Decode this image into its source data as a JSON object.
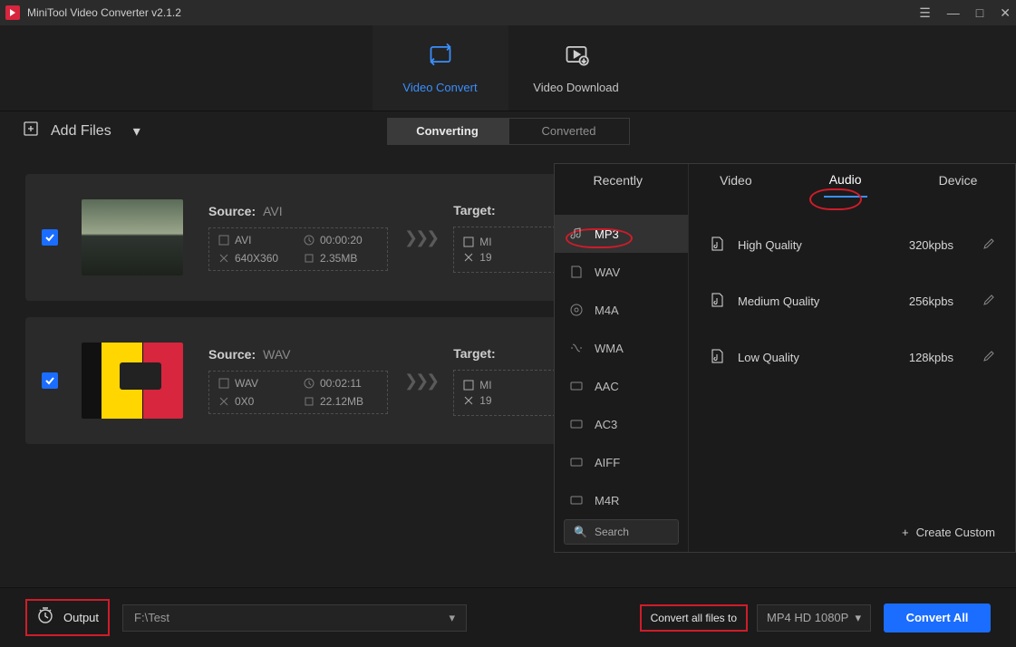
{
  "app": {
    "title": "MiniTool Video Converter v2.1.2"
  },
  "nav": {
    "convert": "Video Convert",
    "download": "Video Download"
  },
  "toolbar": {
    "add_files": "Add Files",
    "converting": "Converting",
    "converted": "Converted"
  },
  "files": [
    {
      "source_label": "Source:",
      "source_fmt": "AVI",
      "codec": "AVI",
      "duration": "00:00:20",
      "res": "640X360",
      "size": "2.35MB",
      "target_label": "Target:",
      "t_codec": "MI",
      "t_res": "19"
    },
    {
      "source_label": "Source:",
      "source_fmt": "WAV",
      "codec": "WAV",
      "duration": "00:02:11",
      "res": "0X0",
      "size": "22.12MB",
      "target_label": "Target:",
      "t_codec": "MI",
      "t_res": "19"
    }
  ],
  "popup": {
    "tabs": {
      "recently": "Recently",
      "video": "Video",
      "audio": "Audio",
      "device": "Device"
    },
    "formats": [
      "MP3",
      "WAV",
      "M4A",
      "WMA",
      "AAC",
      "AC3",
      "AIFF",
      "M4R"
    ],
    "search_placeholder": "Search",
    "qualities": [
      {
        "name": "High Quality",
        "rate": "320kpbs"
      },
      {
        "name": "Medium Quality",
        "rate": "256kpbs"
      },
      {
        "name": "Low Quality",
        "rate": "128kpbs"
      }
    ],
    "create_custom": "Create Custom"
  },
  "footer": {
    "output_label": "Output",
    "output_path": "F:\\Test",
    "convert_all_label": "Convert all files to",
    "format_selected": "MP4 HD 1080P",
    "convert_all_btn": "Convert All"
  }
}
